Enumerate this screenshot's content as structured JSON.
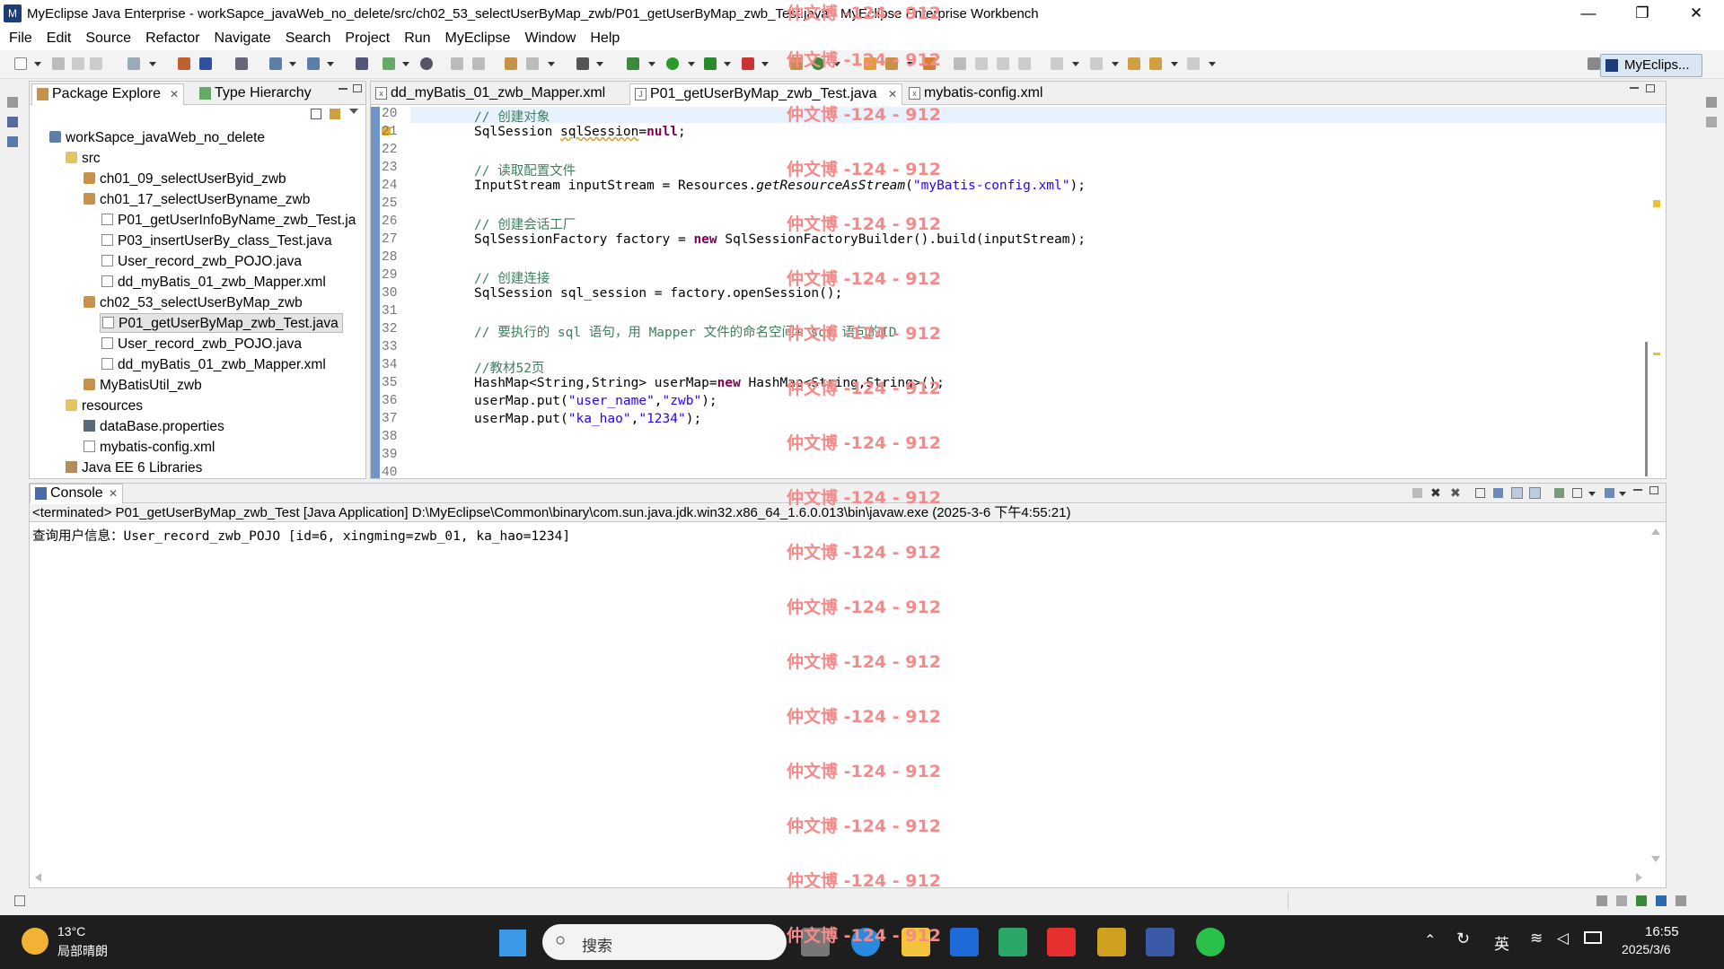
{
  "window": {
    "title": "MyEclipse Java Enterprise - workSapce_javaWeb_no_delete/src/ch02_53_selectUserByMap_zwb/P01_getUserByMap_zwb_Test.java - MyEclipse Enterprise Workbench",
    "minimize": "—",
    "maximize": "❐",
    "close": "✕"
  },
  "menu": [
    "File",
    "Edit",
    "Source",
    "Refactor",
    "Navigate",
    "Search",
    "Project",
    "Run",
    "MyEclipse",
    "Window",
    "Help"
  ],
  "perspective": "MyEclips...",
  "explorer": {
    "tabs": [
      {
        "label": "Package Explore"
      },
      {
        "label": "Type Hierarchy"
      }
    ],
    "tree": [
      {
        "label": "workSapce_javaWeb_no_delete",
        "icon": "project-icon"
      },
      {
        "label": "src",
        "icon": "folder-icon"
      },
      {
        "label": "ch01_09_selectUserByid_zwb",
        "icon": "package-icon"
      },
      {
        "label": "ch01_17_selectUserByname_zwb",
        "icon": "package-icon"
      },
      {
        "label": "P01_getUserInfoByName_zwb_Test.ja",
        "icon": "java-file-icon"
      },
      {
        "label": "P03_insertUserBy_class_Test.java",
        "icon": "java-file-icon"
      },
      {
        "label": "User_record_zwb_POJO.java",
        "icon": "java-file-icon"
      },
      {
        "label": "dd_myBatis_01_zwb_Mapper.xml",
        "icon": "xml-file-icon"
      },
      {
        "label": "ch02_53_selectUserByMap_zwb",
        "icon": "package-icon"
      },
      {
        "label": "P01_getUserByMap_zwb_Test.java",
        "icon": "java-file-icon"
      },
      {
        "label": "User_record_zwb_POJO.java",
        "icon": "java-file-icon"
      },
      {
        "label": "dd_myBatis_01_zwb_Mapper.xml",
        "icon": "xml-file-icon"
      },
      {
        "label": "MyBatisUtil_zwb",
        "icon": "package-icon"
      },
      {
        "label": "resources",
        "icon": "folder-icon"
      },
      {
        "label": "dataBase.properties",
        "icon": "properties-file-icon"
      },
      {
        "label": "mybatis-config.xml",
        "icon": "xml-file-icon"
      },
      {
        "label": "Java EE 6 Libraries",
        "icon": "library-icon"
      }
    ]
  },
  "editor": {
    "tabs": [
      {
        "label": "dd_myBatis_01_zwb_Mapper.xml"
      },
      {
        "label": "P01_getUserByMap_zwb_Test.java"
      },
      {
        "label": "mybatis-config.xml"
      }
    ],
    "line_numbers": [
      "20",
      "21",
      "22",
      "23",
      "24",
      "25",
      "26",
      "27",
      "28",
      "29",
      "30",
      "31",
      "32",
      "33",
      "34",
      "35",
      "36",
      "37",
      "38",
      "39",
      "40"
    ],
    "code": {
      "l20": "// 创建对象",
      "l21a": "SqlSession ",
      "l21b": "sqlSession",
      "l21c": "=",
      "l21d": "null",
      "l21e": ";",
      "l23": "// 读取配置文件",
      "l24a": "InputStream inputStream = Resources.",
      "l24b": "getResourceAsStream",
      "l24c": "(",
      "l24d": "\"myBatis-config.xml\"",
      "l24e": ");",
      "l26": "// 创建会话工厂",
      "l27a": "SqlSessionFactory factory = ",
      "l27b": "new",
      "l27c": " SqlSessionFactoryBuilder().build(inputStream);",
      "l29": "// 创建连接",
      "l30": "SqlSession sql_session = factory.openSession();",
      "l32": "// 要执行的 sql 语句，用 Mapper 文件的命名空间+ sql 语句的ID",
      "l34": "//教材52页",
      "l35a": "HashMap<String,String> userMap=",
      "l35b": "new",
      "l35c": " HashMap<String,String>();",
      "l36a": "userMap.put(",
      "l36b": "\"user_name\"",
      "l36c": ",",
      "l36d": "\"zwb\"",
      "l36e": ");",
      "l37a": "userMap.put(",
      "l37b": "\"ka_hao\"",
      "l37c": ",",
      "l37d": "\"1234\"",
      "l37e": ");"
    }
  },
  "console": {
    "tab": "Console",
    "status": "<terminated> P01_getUserByMap_zwb_Test [Java Application] D:\\MyEclipse\\Common\\binary\\com.sun.java.jdk.win32.x86_64_1.6.0.013\\bin\\javaw.exe (2025-3-6 下午4:55:21)",
    "output": "查询用户信息：User_record_zwb_POJO [id=6, xingming=zwb_01, ka_hao=1234]"
  },
  "watermark": "仲文博 -124 - 912",
  "taskbar": {
    "weather_temp": "13°C",
    "weather_desc": "局部晴朗",
    "search": "搜索",
    "ime": "英",
    "time": "16:55",
    "date": "2025/3/6"
  },
  "colors": {
    "accent": "#1d3d78",
    "comment": "#3f7f5f",
    "keyword": "#7f0055",
    "string": "#2a00ff",
    "watermark": "#f48a8a"
  }
}
